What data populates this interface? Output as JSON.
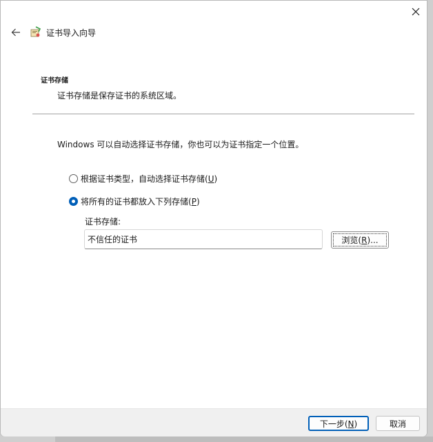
{
  "window": {
    "title": "证书导入向导"
  },
  "header": {
    "section_title": "证书存储",
    "section_desc": "证书存储是保存证书的系统区域。"
  },
  "main": {
    "intro": "Windows 可以自动选择证书存储，你也可以为证书指定一个位置。",
    "option_auto": {
      "label": "根据证书类型，自动选择证书存储(",
      "mnemonic": "U",
      "suffix": ")",
      "checked": false
    },
    "option_manual": {
      "label": "将所有的证书都放入下列存储(",
      "mnemonic": "P",
      "suffix": ")",
      "checked": true
    },
    "store_label": "证书存储:",
    "store_value": "不信任的证书",
    "browse": {
      "label": "浏览(",
      "mnemonic": "R",
      "suffix": ")..."
    }
  },
  "footer": {
    "next": {
      "label": "下一步(",
      "mnemonic": "N",
      "suffix": ")"
    },
    "cancel": "取消"
  },
  "colors": {
    "accent": "#005fb8",
    "footer_bg": "#f0f0f0"
  },
  "icons": {
    "close": "close-icon",
    "back": "arrow-left-icon",
    "wizard": "certificate-icon"
  }
}
